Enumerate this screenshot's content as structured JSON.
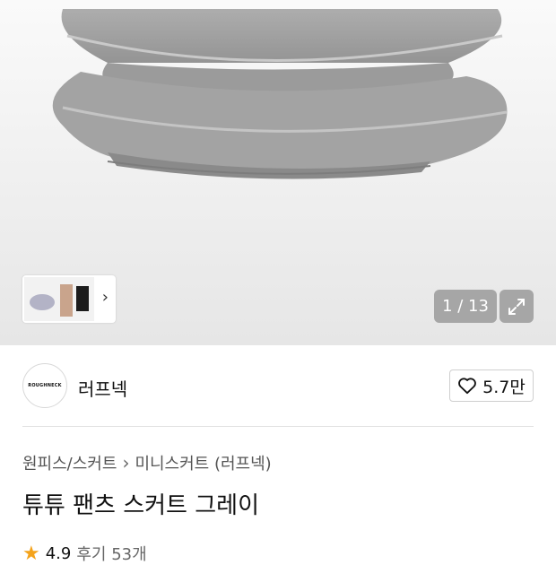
{
  "gallery": {
    "counter_text": "1 / 13",
    "image_alt": "gray tutu skirt",
    "icons": {
      "expand": "expand-icon",
      "next": "chevron-right-icon"
    }
  },
  "brand": {
    "logo_text": "ROUGHNECK",
    "name": "러프넥",
    "likes_label": "5.7만",
    "icon": "heart-icon"
  },
  "breadcrumb": {
    "category": "원피스/스커트",
    "subcategory": "미니스커트 (러프넥)"
  },
  "product": {
    "title": "튜튜 팬츠 스커트 그레이"
  },
  "rating": {
    "score": "4.9",
    "reviews": "후기 53개",
    "color": "#f4a31b"
  },
  "colors": {
    "accent": "#f4a31b",
    "counter_bg": "#828282"
  }
}
